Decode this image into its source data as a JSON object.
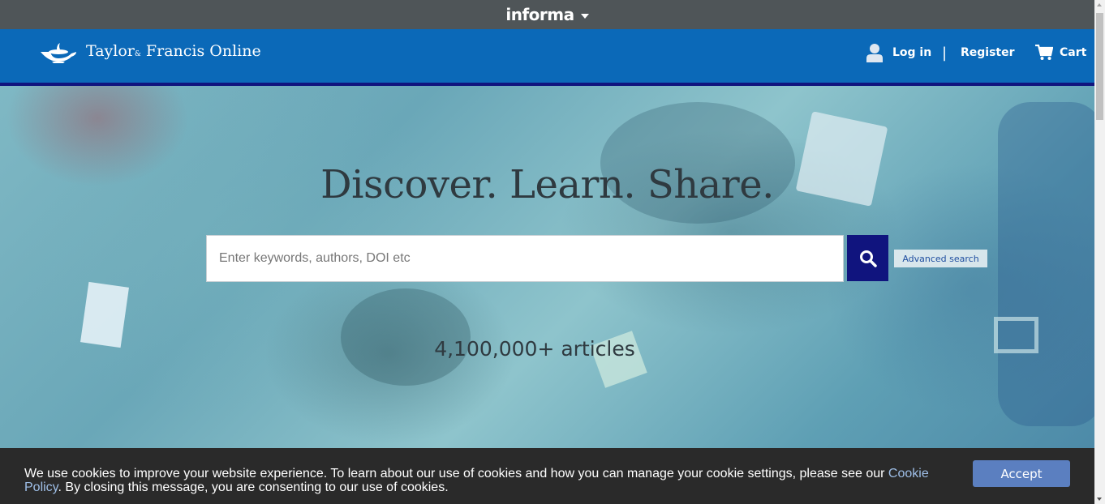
{
  "informa_bar": {
    "brand": "informa",
    "caret_icon": "caret-down-icon"
  },
  "header": {
    "logo_text": "Taylor",
    "logo_amp": "&",
    "logo_text_2": "Francis Online",
    "nav": {
      "login": "Log in",
      "separator": "|",
      "register": "Register",
      "cart": "Cart"
    }
  },
  "hero": {
    "headline": "Discover. Learn. Share.",
    "search": {
      "placeholder": "Enter keywords, authors, DOI etc",
      "value": ""
    },
    "advanced_search": "Advanced search",
    "article_count": "4,100,000+ articles"
  },
  "cookie_banner": {
    "message_before_link": "We use cookies to improve your website experience. To learn about our use of cookies and how you can manage your cookie settings, please see our ",
    "link_text": "Cookie Policy",
    "message_after_link": ". By closing this message, you are consenting to our use of cookies.",
    "accept_label": "Accept"
  },
  "colors": {
    "informa_bar": "#4f5558",
    "header": "#0b69b8",
    "header_underline": "#10147e",
    "search_button": "#10147e",
    "cookie_bg": "#2a2a2a",
    "accept_button": "#5b7fc0",
    "cookie_link": "#9fbfe8"
  }
}
